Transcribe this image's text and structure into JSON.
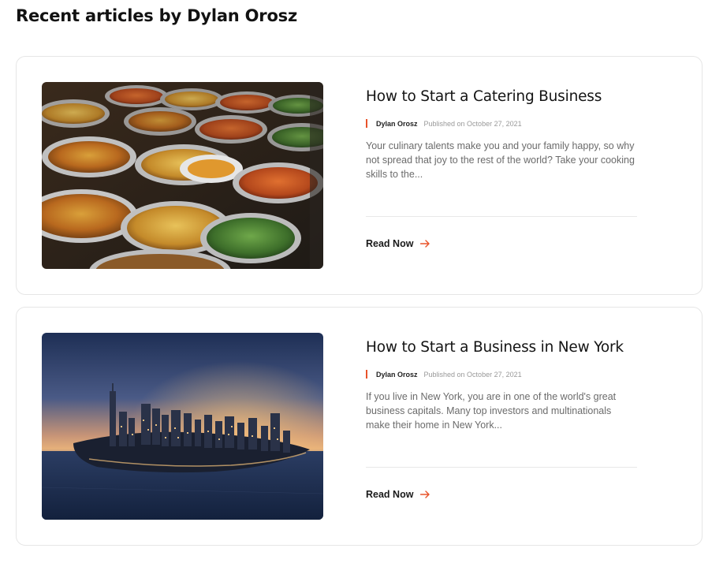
{
  "section": {
    "title": "Recent articles by Dylan Orosz"
  },
  "articles": [
    {
      "title": "How to Start a Catering Business",
      "author": "Dylan Orosz",
      "date": "Published on October 27, 2021",
      "excerpt": "Your culinary talents make you and your family happy, so why not spread that joy to the rest of the world? Take your cooking skills to the...",
      "read_more": "Read Now",
      "image": "catering-buffet-photo"
    },
    {
      "title": "How to Start a Business in New York",
      "author": "Dylan Orosz",
      "date": "Published on October 27, 2021",
      "excerpt": "If you live in New York, you are in one of the world's great business capitals. Many top investors and multinationals make their home in New York...",
      "read_more": "Read Now",
      "image": "new-york-skyline-photo"
    }
  ],
  "colors": {
    "accent": "#e8532a",
    "title": "#141414",
    "excerpt": "#6b6b6b",
    "border": "#e6e6e6"
  }
}
